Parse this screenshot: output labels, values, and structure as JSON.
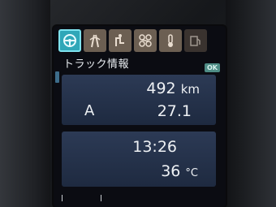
{
  "header": {
    "title": "トラック情報",
    "ok_badge": "OK"
  },
  "tabs": [
    {
      "icon": "steering-wheel-icon",
      "active": true
    },
    {
      "icon": "road-lane-icon",
      "active": false
    },
    {
      "icon": "gear-shift-icon",
      "active": false
    },
    {
      "icon": "gearbox-icon",
      "active": false
    },
    {
      "icon": "temperature-icon",
      "active": false
    },
    {
      "icon": "fuel-settings-icon",
      "active": false
    }
  ],
  "trip": {
    "distance": "492",
    "distance_unit": "km",
    "label": "A",
    "average": "27.1"
  },
  "status": {
    "time": "13:26",
    "temperature": "36",
    "temperature_unit": "°C"
  },
  "colors": {
    "active_tab": "#2fa7b8",
    "inactive_tab": "#6c5f52",
    "panel": "#26334c",
    "text": "#eef1f4"
  }
}
